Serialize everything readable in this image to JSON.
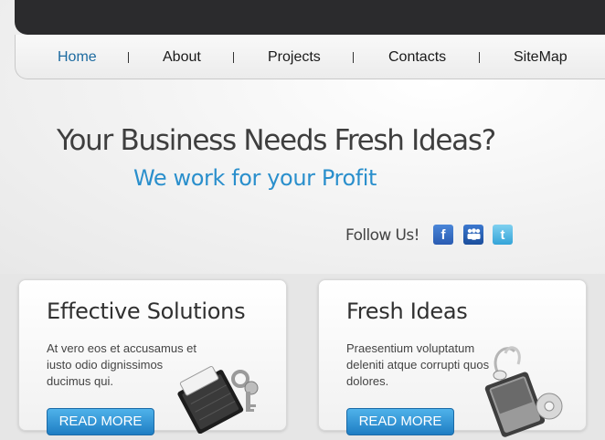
{
  "nav": {
    "items": [
      {
        "label": "Home",
        "active": true
      },
      {
        "label": "About",
        "active": false
      },
      {
        "label": "Projects",
        "active": false
      },
      {
        "label": "Contacts",
        "active": false
      },
      {
        "label": "SiteMap",
        "active": false
      }
    ]
  },
  "hero": {
    "headline": "Your Business Needs Fresh Ideas?",
    "subline": "We work for your Profit"
  },
  "social": {
    "label": "Follow Us!",
    "icons": [
      "facebook-icon",
      "myspace-icon",
      "twitter-icon"
    ],
    "glyphs": {
      "facebook": "f",
      "myspace": "m",
      "twitter": "t"
    }
  },
  "cards": [
    {
      "title": "Effective Solutions",
      "text": "At vero eos et accusamus et iusto odio dignissimos ducimus qui.",
      "button": "READ MORE",
      "icon": "wallet-keys-icon"
    },
    {
      "title": "Fresh Ideas",
      "text": "Praesentium voluptatum deleniti atque corrupti quos dolores.",
      "button": "READ MORE",
      "icon": "mp3-player-icon"
    }
  ],
  "colors": {
    "topbar": "#2b2b2d",
    "accent": "#2a8fcc",
    "nav_active": "#1c6aa0",
    "button": "#1e7dc3"
  }
}
